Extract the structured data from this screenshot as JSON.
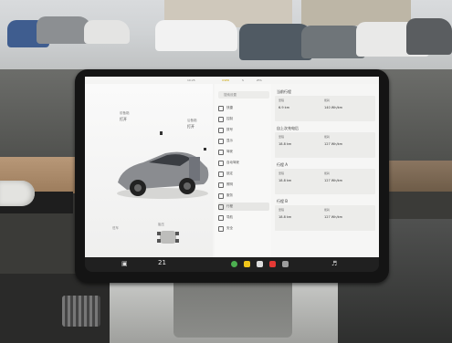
{
  "screen": {
    "status_time": "10:25",
    "status_items": [
      "USER",
      "S",
      "ZTA"
    ],
    "search_placeholder": "搜索设置",
    "car_labels": {
      "frunk": "前备箱",
      "frunk_state": "打开",
      "trunk": "后备箱",
      "trunk_state": "打开"
    },
    "menu_items": [
      {
        "label": "快捷",
        "icon": "toggle-icon"
      },
      {
        "label": "控制",
        "icon": "car-icon"
      },
      {
        "label": "拨号",
        "icon": "phone-icon"
      },
      {
        "label": "显示",
        "icon": "display-icon"
      },
      {
        "label": "驾驶",
        "icon": "steering-icon"
      },
      {
        "label": "自动驾驶",
        "icon": "autopilot-icon"
      },
      {
        "label": "锁定",
        "icon": "lock-icon"
      },
      {
        "label": "照明",
        "icon": "light-icon"
      },
      {
        "label": "服务",
        "icon": "service-icon"
      },
      {
        "label": "行程",
        "icon": "trip-icon",
        "active": true
      },
      {
        "label": "导航",
        "icon": "nav-icon"
      },
      {
        "label": "安全",
        "icon": "shield-icon"
      }
    ],
    "detail_cards": [
      {
        "title": "当前行程",
        "k1": "里程",
        "v1": "6.9 km",
        "k2": "能耗",
        "v2": "140 Wh/km"
      },
      {
        "title": "自上次充电后",
        "k1": "里程",
        "v1": "18.8 km",
        "k2": "能耗",
        "v2": "127 Wh/km"
      },
      {
        "title": "行程 A",
        "k1": "里程",
        "v1": "18.8 km",
        "k2": "能耗",
        "v2": "127 Wh/km"
      },
      {
        "title": "行程 B",
        "k1": "里程",
        "v1": "18.8 km",
        "k2": "能耗",
        "v2": "127 Wh/km"
      }
    ],
    "bottom_left": {
      "label": "驻车",
      "pressure_label": "胎压"
    },
    "dock_temp": "21"
  },
  "colors": {
    "screen_bg": "#f4f4f3",
    "accent_blue": "#3e6ae1",
    "car_body": "#8a8c90"
  }
}
